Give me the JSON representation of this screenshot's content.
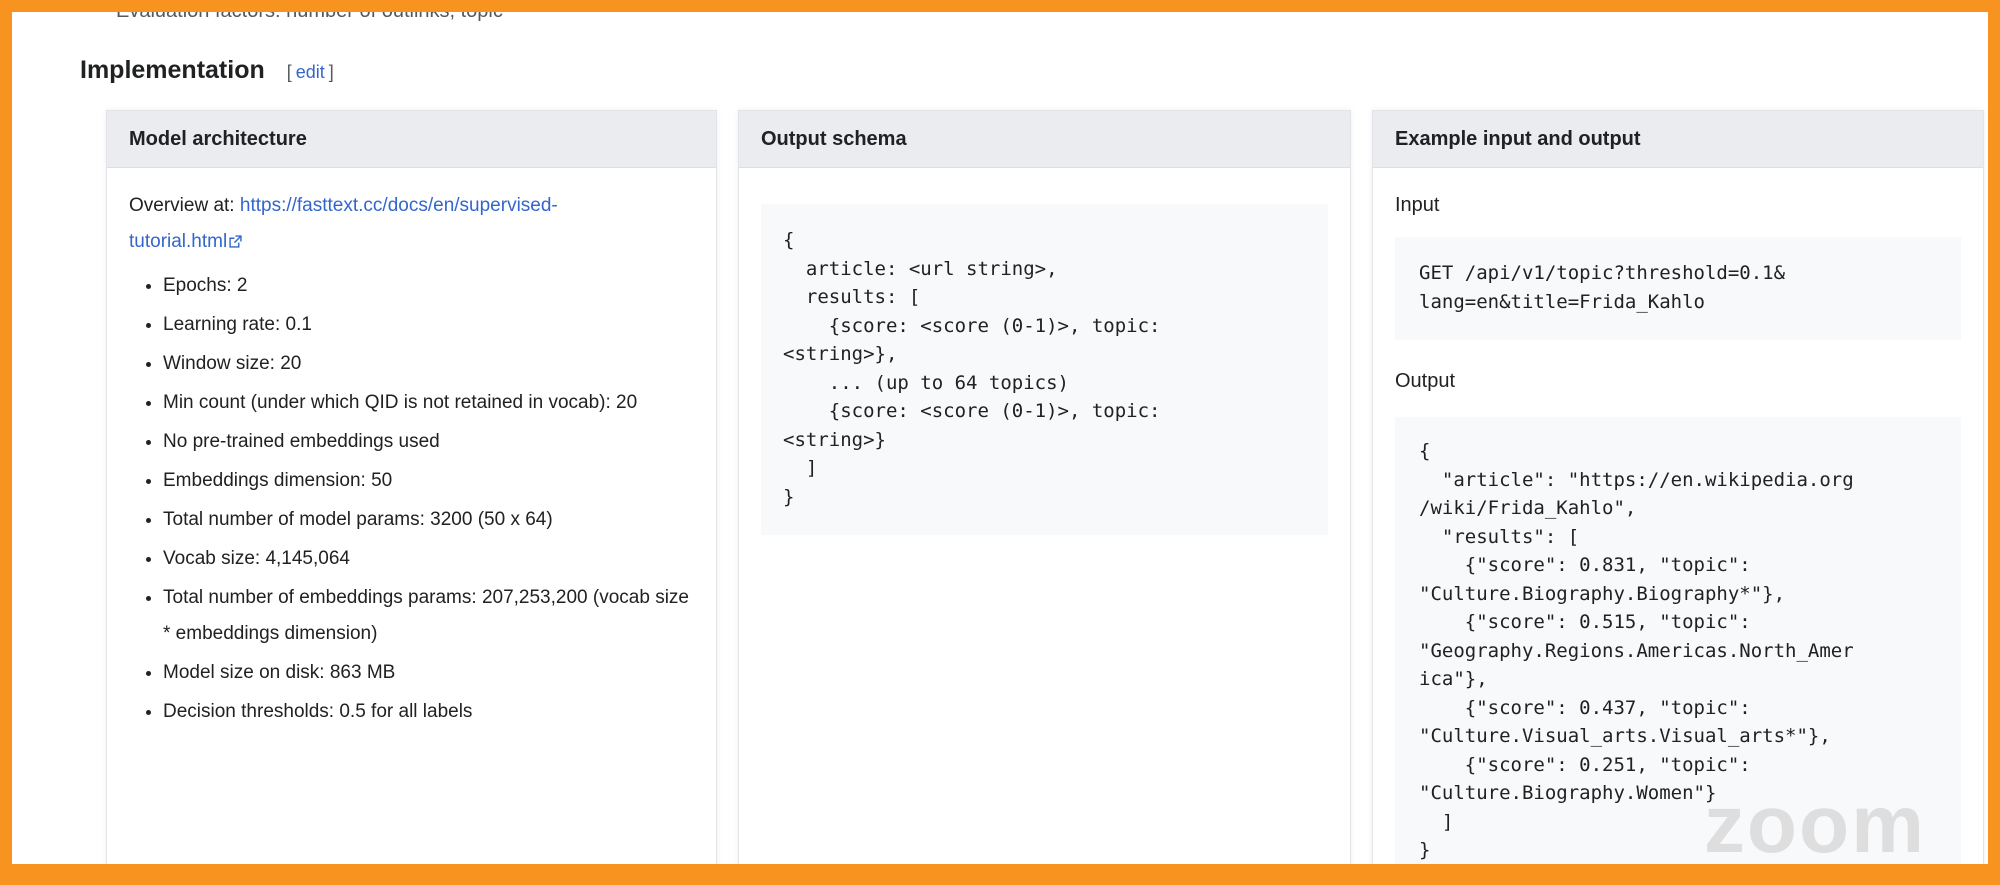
{
  "cut_off_text": "Evaluation factors: number of outlinks, topic",
  "section": {
    "title": "Implementation",
    "edit_open": "[",
    "edit_label": "edit",
    "edit_close": "]"
  },
  "panels": {
    "model": {
      "title": "Model architecture",
      "overview_prefix": "Overview at: ",
      "overview_link_line1": "https://fasttext.cc/docs/en/supervised-",
      "overview_link_line2": "tutorial.html",
      "items": [
        "Epochs: 2",
        "Learning rate: 0.1",
        "Window size: 20",
        "Min count (under which QID is not retained in vocab): 20",
        "No pre-trained embeddings used",
        "Embeddings dimension: 50",
        "Total number of model params: 3200 (50 x 64)",
        "Vocab size: 4,145,064",
        "Total number of embeddings params: 207,253,200 (vocab size * embeddings dimension)",
        "Model size on disk: 863 MB",
        "Decision thresholds: 0.5 for all labels"
      ]
    },
    "schema": {
      "title": "Output schema",
      "code": "{\n  article: <url string>,\n  results: [\n    {score: <score (0-1)>, topic:\n<string>},\n    ... (up to 64 topics)\n    {score: <score (0-1)>, topic:\n<string>}\n  ]\n}"
    },
    "example": {
      "title": "Example input and output",
      "input_label": "Input",
      "input_code": "GET /api/v1/topic?threshold=0.1&\nlang=en&title=Frida_Kahlo",
      "output_label": "Output",
      "output_code": "{\n  \"article\": \"https://en.wikipedia.org\n/wiki/Frida_Kahlo\",\n  \"results\": [\n    {\"score\": 0.831, \"topic\":\n\"Culture.Biography.Biography*\"},\n    {\"score\": 0.515, \"topic\":\n\"Geography.Regions.Americas.North_Amer\nica\"},\n    {\"score\": 0.437, \"topic\":\n\"Culture.Visual_arts.Visual_arts*\"},\n    {\"score\": 0.251, \"topic\":\n\"Culture.Biography.Women\"}\n  ]\n}"
    }
  },
  "watermark": "zoom",
  "colors": {
    "border_frame": "#f7931e",
    "link": "#3366cc",
    "panel_header": "#eaecf0"
  }
}
